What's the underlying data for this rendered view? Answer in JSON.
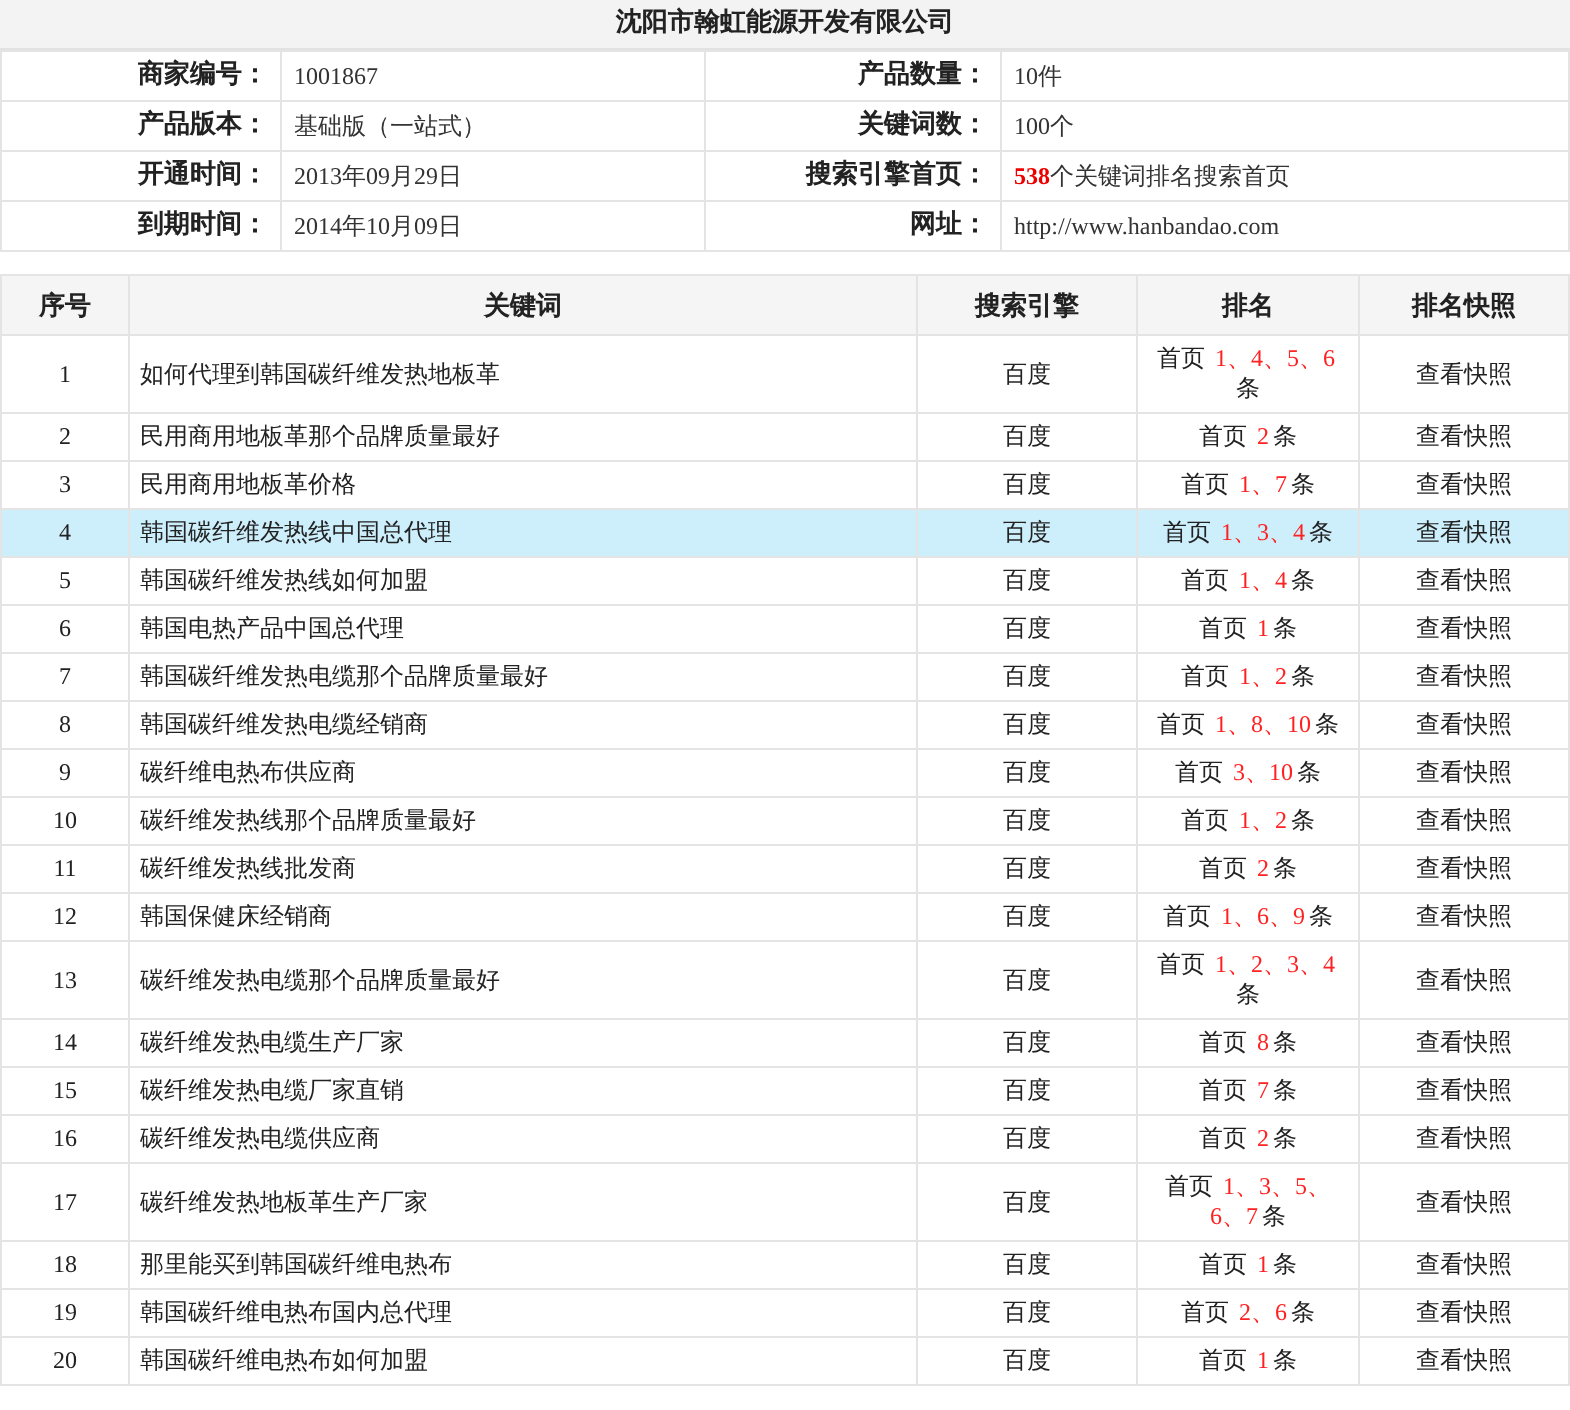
{
  "company": {
    "title": "沈阳市翰虹能源开发有限公司"
  },
  "info": [
    {
      "label": "商家编号：",
      "value": "1001867",
      "label2": "产品数量：",
      "value2": "10件"
    },
    {
      "label": "产品版本：",
      "value": "基础版（一站式）",
      "label2": "关键词数：",
      "value2": "100个"
    },
    {
      "label": "开通时间：",
      "value": "2013年09月29日",
      "label2": "搜索引擎首页：",
      "count": "538",
      "value2": "个关键词排名搜索首页"
    },
    {
      "label": "到期时间：",
      "value": "2014年10月09日",
      "label2": "网址：",
      "value2": "http://www.hanbandao.com"
    }
  ],
  "table": {
    "columns": [
      "序号",
      "关键词",
      "搜索引擎",
      "排名",
      "排名快照"
    ],
    "rows": [
      {
        "no": "1",
        "keyword": "如何代理到韩国碳纤维发热地板革",
        "engine": "百度",
        "prefix": "首页",
        "positions": "1、4、5、6",
        "suffix": "条",
        "snapshot": "查看快照",
        "selected": false
      },
      {
        "no": "2",
        "keyword": "民用商用地板革那个品牌质量最好",
        "engine": "百度",
        "prefix": "首页",
        "positions": "2",
        "suffix": "条",
        "snapshot": "查看快照",
        "selected": false
      },
      {
        "no": "3",
        "keyword": "民用商用地板革价格",
        "engine": "百度",
        "prefix": "首页",
        "positions": "1、7",
        "suffix": "条",
        "snapshot": "查看快照",
        "selected": false
      },
      {
        "no": "4",
        "keyword": "韩国碳纤维发热线中国总代理",
        "engine": "百度",
        "prefix": "首页",
        "positions": "1、3、4",
        "suffix": "条",
        "snapshot": "查看快照",
        "selected": true
      },
      {
        "no": "5",
        "keyword": "韩国碳纤维发热线如何加盟",
        "engine": "百度",
        "prefix": "首页",
        "positions": "1、4",
        "suffix": "条",
        "snapshot": "查看快照",
        "selected": false
      },
      {
        "no": "6",
        "keyword": "韩国电热产品中国总代理",
        "engine": "百度",
        "prefix": "首页",
        "positions": "1",
        "suffix": "条",
        "snapshot": "查看快照",
        "selected": false
      },
      {
        "no": "7",
        "keyword": "韩国碳纤维发热电缆那个品牌质量最好",
        "engine": "百度",
        "prefix": "首页",
        "positions": "1、2",
        "suffix": "条",
        "snapshot": "查看快照",
        "selected": false
      },
      {
        "no": "8",
        "keyword": "韩国碳纤维发热电缆经销商",
        "engine": "百度",
        "prefix": "首页",
        "positions": "1、8、10",
        "suffix": "条",
        "snapshot": "查看快照",
        "selected": false
      },
      {
        "no": "9",
        "keyword": "碳纤维电热布供应商",
        "engine": "百度",
        "prefix": "首页",
        "positions": "3、10",
        "suffix": "条",
        "snapshot": "查看快照",
        "selected": false
      },
      {
        "no": "10",
        "keyword": "碳纤维发热线那个品牌质量最好",
        "engine": "百度",
        "prefix": "首页",
        "positions": "1、2",
        "suffix": "条",
        "snapshot": "查看快照",
        "selected": false
      },
      {
        "no": "11",
        "keyword": "碳纤维发热线批发商",
        "engine": "百度",
        "prefix": "首页",
        "positions": "2",
        "suffix": "条",
        "snapshot": "查看快照",
        "selected": false
      },
      {
        "no": "12",
        "keyword": "韩国保健床经销商",
        "engine": "百度",
        "prefix": "首页",
        "positions": "1、6、9",
        "suffix": "条",
        "snapshot": "查看快照",
        "selected": false
      },
      {
        "no": "13",
        "keyword": "碳纤维发热电缆那个品牌质量最好",
        "engine": "百度",
        "prefix": "首页",
        "positions": "1、2、3、4",
        "suffix": "条",
        "snapshot": "查看快照",
        "selected": false
      },
      {
        "no": "14",
        "keyword": "碳纤维发热电缆生产厂家",
        "engine": "百度",
        "prefix": "首页",
        "positions": "8",
        "suffix": "条",
        "snapshot": "查看快照",
        "selected": false
      },
      {
        "no": "15",
        "keyword": "碳纤维发热电缆厂家直销",
        "engine": "百度",
        "prefix": "首页",
        "positions": "7",
        "suffix": "条",
        "snapshot": "查看快照",
        "selected": false
      },
      {
        "no": "16",
        "keyword": "碳纤维发热电缆供应商",
        "engine": "百度",
        "prefix": "首页",
        "positions": "2",
        "suffix": "条",
        "snapshot": "查看快照",
        "selected": false
      },
      {
        "no": "17",
        "keyword": "碳纤维发热地板革生产厂家",
        "engine": "百度",
        "prefix": "首页",
        "positions": "1、3、5、6、7",
        "suffix": "条",
        "snapshot": "查看快照",
        "selected": false
      },
      {
        "no": "18",
        "keyword": "那里能买到韩国碳纤维电热布",
        "engine": "百度",
        "prefix": "首页",
        "positions": "1",
        "suffix": "条",
        "snapshot": "查看快照",
        "selected": false
      },
      {
        "no": "19",
        "keyword": "韩国碳纤维电热布国内总代理",
        "engine": "百度",
        "prefix": "首页",
        "positions": "2、6",
        "suffix": "条",
        "snapshot": "查看快照",
        "selected": false
      },
      {
        "no": "20",
        "keyword": "韩国碳纤维电热布如何加盟",
        "engine": "百度",
        "prefix": "首页",
        "positions": "1",
        "suffix": "条",
        "snapshot": "查看快照",
        "selected": false
      }
    ]
  }
}
